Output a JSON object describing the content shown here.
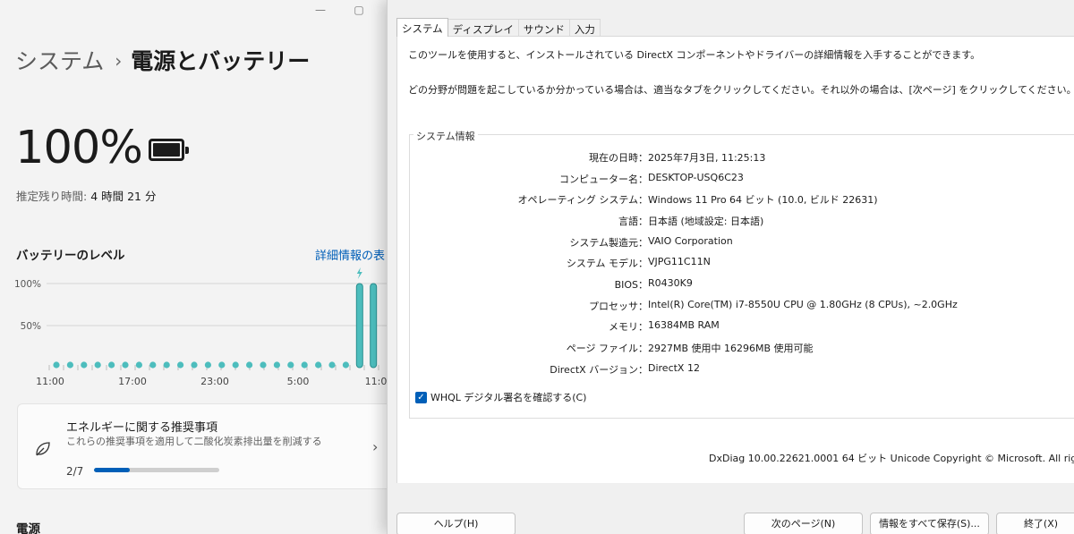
{
  "settings": {
    "breadcrumb_parent": "システム",
    "breadcrumb_separator": "›",
    "page_title": "電源とバッテリー",
    "battery_percent": "100%",
    "battery_level_fraction": 1.0,
    "remaining_label": "推定残り時間:",
    "remaining_value": "4 時間 21 分",
    "level_title": "バッテリーのレベル",
    "details_link": "詳細情報の表",
    "recommendation": {
      "title": "エネルギーに関する推奨事項",
      "subtitle": "これらの推奨事項を適用して二酸化炭素排出量を削減する",
      "count": "2/7",
      "progress_fraction": 0.2857
    },
    "power_label": "電源",
    "accent_color": "#005fb8",
    "chart_color": "#4dbdbd"
  },
  "chart_data": {
    "type": "bar",
    "title": "",
    "y_ticks": [
      "100%",
      "50%"
    ],
    "x_ticks": [
      "11:00",
      "17:00",
      "23:00",
      "5:00",
      "11:0"
    ],
    "ylim": [
      0,
      100
    ],
    "values": [
      0,
      0,
      0,
      0,
      0,
      0,
      0,
      0,
      0,
      0,
      0,
      0,
      0,
      0,
      0,
      0,
      0,
      0,
      0,
      0,
      0,
      0,
      100,
      100
    ],
    "charging_marker_index": 22,
    "charging_icon": "lightning-icon"
  },
  "dxdiag": {
    "tabs": [
      "システム",
      "ディスプレイ",
      "サウンド",
      "入力"
    ],
    "active_tab": 0,
    "intro1": "このツールを使用すると、インストールされている DirectX コンポーネントやドライバーの詳細情報を入手することができます。",
    "intro2": "どの分野が問題を起こしているか分かっている場合は、適当なタブをクリックしてください。それ以外の場合は、[次ページ] をクリックしてください。",
    "sysinfo_legend": "システム情報",
    "rows": [
      {
        "label": "現在の日時：",
        "value": "2025年7月3日, 11:25:13"
      },
      {
        "label": "コンピューター名：",
        "value": "DESKTOP-USQ6C23"
      },
      {
        "label": "オペレーティング システム：",
        "value": "Windows 11 Pro 64 ビット (10.0, ビルド 22631)"
      },
      {
        "label": "言語：",
        "value": "日本語 (地域設定: 日本語)"
      },
      {
        "label": "システム製造元：",
        "value": "VAIO Corporation"
      },
      {
        "label": "システム モデル：",
        "value": "VJPG11C11N"
      },
      {
        "label": "BIOS：",
        "value": "R0430K9"
      },
      {
        "label": "プロセッサ：",
        "value": "Intel(R) Core(TM) i7-8550U CPU @ 1.80GHz (8 CPUs), ~2.0GHz"
      },
      {
        "label": "メモリ：",
        "value": "16384MB RAM"
      },
      {
        "label": "ページ ファイル：",
        "value": "2927MB 使用中 16296MB 使用可能"
      },
      {
        "label": "DirectX バージョン：",
        "value": "DirectX 12"
      }
    ],
    "whql_label": "WHQL デジタル署名を確認する(C)",
    "whql_checked": true,
    "version_line": "DxDiag 10.00.22621.0001 64 ビット Unicode  Copyright © Microsoft. All rights rese",
    "buttons": {
      "help": "ヘルプ(H)",
      "next": "次のページ(N)",
      "save": "情報をすべて保存(S)...",
      "exit": "終了(X)"
    }
  }
}
